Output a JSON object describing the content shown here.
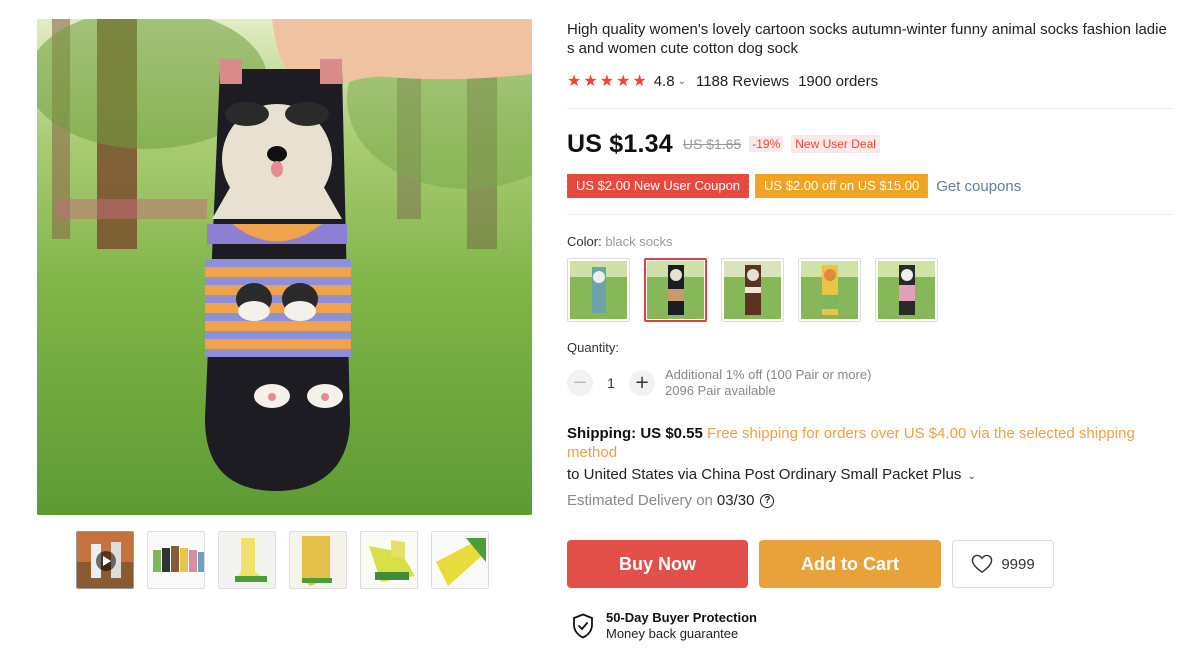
{
  "product": {
    "title": "High quality women's lovely cartoon socks autumn-winter funny animal socks fashion ladies and women cute cotton dog sock",
    "rating": "4.8",
    "reviews": "1188 Reviews",
    "orders": "1900 orders"
  },
  "price": {
    "current": "US $1.34",
    "original": "US $1.65",
    "discount": "-19%",
    "deal_tag": "New User Deal"
  },
  "coupons": {
    "coupon1": "US $2.00 New User Coupon",
    "coupon2": "US $2.00 off on US $15.00",
    "get_link": "Get coupons"
  },
  "color": {
    "label": "Color:",
    "selected": "black socks",
    "options": [
      "grey-blue socks",
      "black socks",
      "brown socks",
      "yellow socks",
      "pink socks"
    ]
  },
  "quantity": {
    "label": "Quantity:",
    "value": "1",
    "note1": "Additional 1% off (100 Pair or more)",
    "note2": "2096 Pair available"
  },
  "shipping": {
    "label": "Shipping:",
    "cost": "US $0.55",
    "free_note": "Free shipping for orders over US $4.00 via the selected shipping method",
    "to": "to United States via China Post Ordinary Small Packet Plus",
    "delivery_label": "Estimated Delivery on",
    "delivery_date": "03/30"
  },
  "actions": {
    "buy": "Buy Now",
    "cart": "Add to Cart",
    "wish_count": "9999"
  },
  "protection": {
    "title": "50-Day Buyer Protection",
    "subtitle": "Money back guarantee"
  },
  "colors": {
    "star": "#f44336",
    "buy": "#e3504a",
    "cart": "#e9a23a",
    "link": "#5c7fa3",
    "free_shipping": "#f0a047"
  }
}
